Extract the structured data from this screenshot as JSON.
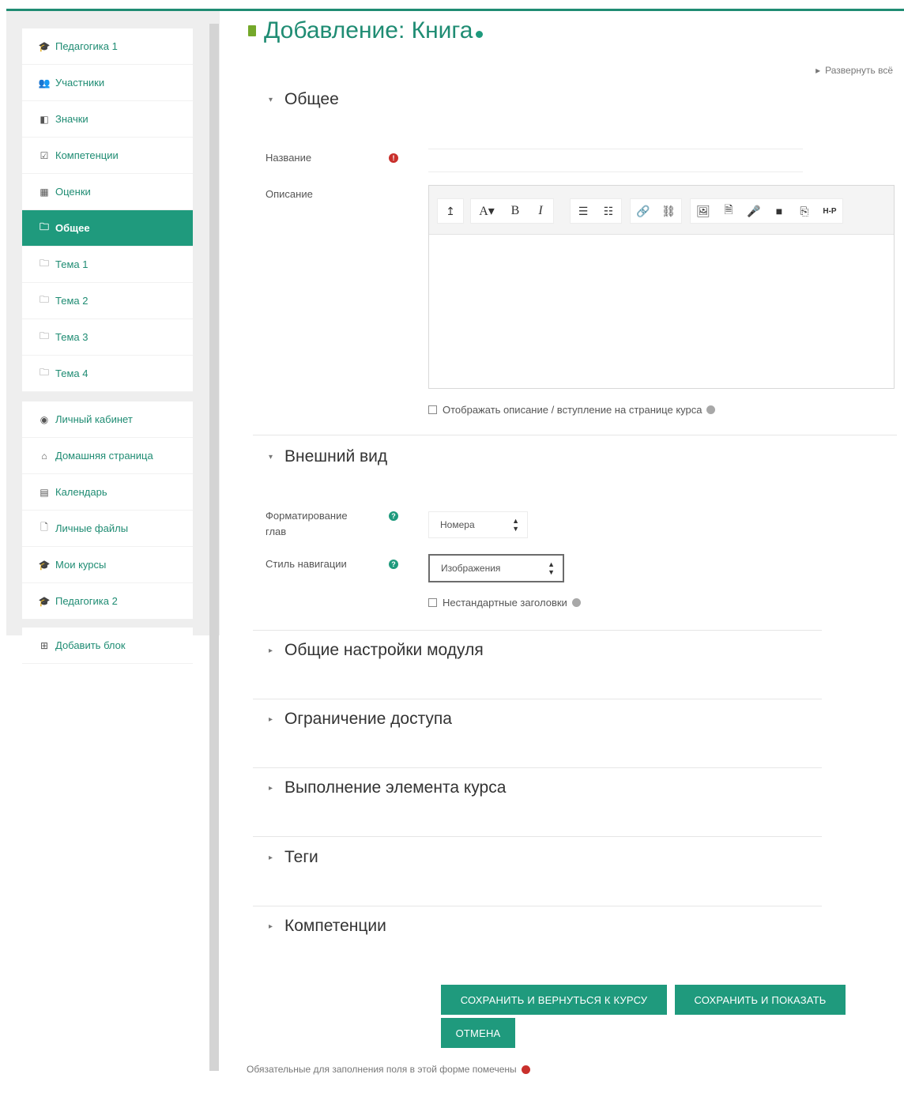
{
  "sidebar": {
    "group1": [
      {
        "label": "Педагогика 1",
        "icon": "graduation-cap-icon",
        "glyph": "🎓"
      },
      {
        "label": "Участники",
        "icon": "users-icon",
        "glyph": "👥"
      },
      {
        "label": "Значки",
        "icon": "shield-icon",
        "glyph": "◧"
      },
      {
        "label": "Компетенции",
        "icon": "checkbox-icon",
        "glyph": "☑"
      },
      {
        "label": "Оценки",
        "icon": "table-icon",
        "glyph": "▦"
      },
      {
        "label": "Общее",
        "icon": "folder-icon",
        "glyph": "🗀",
        "active": true
      },
      {
        "label": "Тема 1",
        "icon": "folder-icon",
        "glyph": "🗀"
      },
      {
        "label": "Тема 2",
        "icon": "folder-icon",
        "glyph": "🗀"
      },
      {
        "label": "Тема 3",
        "icon": "folder-icon",
        "glyph": "🗀"
      },
      {
        "label": "Тема 4",
        "icon": "folder-icon",
        "glyph": "🗀"
      }
    ],
    "group2": [
      {
        "label": "Личный кабинет",
        "icon": "dashboard-icon",
        "glyph": "◉"
      },
      {
        "label": "Домашняя страница",
        "icon": "home-icon",
        "glyph": "⌂"
      },
      {
        "label": "Календарь",
        "icon": "calendar-icon",
        "glyph": "▤"
      },
      {
        "label": "Личные файлы",
        "icon": "file-icon",
        "glyph": "🗋"
      },
      {
        "label": "Мои курсы",
        "icon": "graduation-cap-icon",
        "glyph": "🎓"
      },
      {
        "label": "Педагогика 2",
        "icon": "graduation-cap-icon",
        "glyph": "🎓"
      }
    ],
    "group3": [
      {
        "label": "Добавить блок",
        "icon": "plus-square-icon",
        "glyph": "⊞"
      }
    ]
  },
  "header": {
    "title": "Добавление: Книга",
    "expand_all": "Развернуть всё"
  },
  "sections": {
    "general": "Общее",
    "appearance": "Внешний вид",
    "module_settings": "Общие настройки модуля",
    "access": "Ограничение доступа",
    "completion": "Выполнение элемента курса",
    "tags": "Теги",
    "competencies": "Компетенции"
  },
  "form": {
    "name_label": "Название",
    "name_value": "",
    "description_label": "Описание",
    "show_description": "Отображать описание / вступление на странице курса",
    "chapter_format_label": "Форматирование глав",
    "chapter_format_value": "Номера",
    "nav_style_label": "Стиль навигации",
    "nav_style_value": "Изображения",
    "custom_titles": "Нестандартные заголовки"
  },
  "toolbar": {
    "buttons": [
      "↥",
      "A▾",
      "B",
      "I",
      "☰",
      "☷",
      "🔗",
      "⛓",
      "🖼",
      "🗎",
      "🎤",
      "■",
      "⎘",
      "H-P"
    ]
  },
  "actions": {
    "save_return": "СОХРАНИТЬ И ВЕРНУТЬСЯ К КУРСУ",
    "save_display": "СОХРАНИТЬ И ПОКАЗАТЬ",
    "cancel": "ОТМЕНА"
  },
  "footnote": "Обязательные для заполнения поля в этой форме помечены"
}
